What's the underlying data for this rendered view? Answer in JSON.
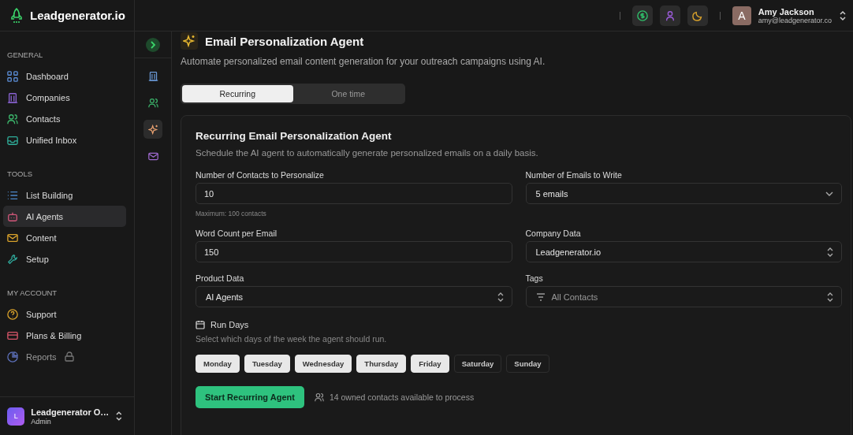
{
  "brand": {
    "name": "Leadgenerator.io"
  },
  "sidebar": {
    "sections": [
      {
        "title": "GENERAL",
        "items": [
          {
            "label": "Dashboard",
            "kind": "grid",
            "selected": false,
            "locked": false
          },
          {
            "label": "Companies",
            "kind": "building",
            "selected": false,
            "locked": false
          },
          {
            "label": "Contacts",
            "kind": "users",
            "selected": false,
            "locked": false
          },
          {
            "label": "Unified Inbox",
            "kind": "inbox",
            "selected": false,
            "locked": false
          }
        ]
      },
      {
        "title": "TOOLS",
        "items": [
          {
            "label": "List Building",
            "kind": "list",
            "selected": false,
            "locked": false
          },
          {
            "label": "AI Agents",
            "kind": "bot",
            "selected": true,
            "locked": false
          },
          {
            "label": "Content",
            "kind": "mail",
            "selected": false,
            "locked": false
          },
          {
            "label": "Setup",
            "kind": "wrench",
            "selected": false,
            "locked": false
          }
        ]
      },
      {
        "title": "MY ACCOUNT",
        "items": [
          {
            "label": "Support",
            "kind": "help",
            "selected": false,
            "locked": false
          },
          {
            "label": "Plans & Billing",
            "kind": "card",
            "selected": false,
            "locked": false
          },
          {
            "label": "Reports",
            "kind": "pie",
            "selected": false,
            "locked": true
          }
        ]
      }
    ],
    "org": {
      "initial": "L",
      "name": "Leadgenerator O…",
      "role": "Admin"
    }
  },
  "rail": [
    {
      "kind": "building",
      "selected": false
    },
    {
      "kind": "users",
      "selected": false
    },
    {
      "kind": "sparkles",
      "selected": true
    },
    {
      "kind": "mail",
      "selected": false
    }
  ],
  "topbar": {
    "buttons": [
      {
        "kind": "dollar"
      },
      {
        "kind": "user"
      },
      {
        "kind": "moon"
      }
    ],
    "user": {
      "initial": "A",
      "name": "Amy Jackson",
      "email": "amy@leadgenerator.co"
    }
  },
  "page": {
    "title": "Email Personalization Agent",
    "description": "Automate personalized email content generation for your outreach campaigns using AI.",
    "tabs": [
      {
        "label": "Recurring",
        "selected": true
      },
      {
        "label": "One time",
        "selected": false
      }
    ]
  },
  "card": {
    "title": "Recurring Email Personalization Agent",
    "description": "Schedule the AI agent to automatically generate personalized emails on a daily basis.",
    "fields": [
      {
        "label": "Number of Contacts to Personalize",
        "kind": "input",
        "value": "10",
        "hint": "Maximum: 100 contacts"
      },
      {
        "label": "Number of Emails to Write",
        "kind": "dropdown",
        "value": "5 emails"
      },
      {
        "label": "Word Count per Email",
        "kind": "input",
        "value": "150"
      },
      {
        "label": "Company Data",
        "kind": "select",
        "value": "Leadgenerator.io"
      },
      {
        "label": "Product Data",
        "kind": "select",
        "value": "AI Agents"
      },
      {
        "label": "Tags",
        "kind": "filter",
        "placeholder": "All Contacts"
      }
    ],
    "run_days": {
      "title": "Run Days",
      "description": "Select which days of the week the agent should run.",
      "days": [
        {
          "label": "Monday",
          "selected": true
        },
        {
          "label": "Tuesday",
          "selected": true
        },
        {
          "label": "Wednesday",
          "selected": true
        },
        {
          "label": "Thursday",
          "selected": true
        },
        {
          "label": "Friday",
          "selected": true
        },
        {
          "label": "Saturday",
          "selected": false
        },
        {
          "label": "Sunday",
          "selected": false
        }
      ]
    },
    "start_button": "Start Recurring Agent",
    "contacts_note": "14 owned contacts available to process"
  }
}
